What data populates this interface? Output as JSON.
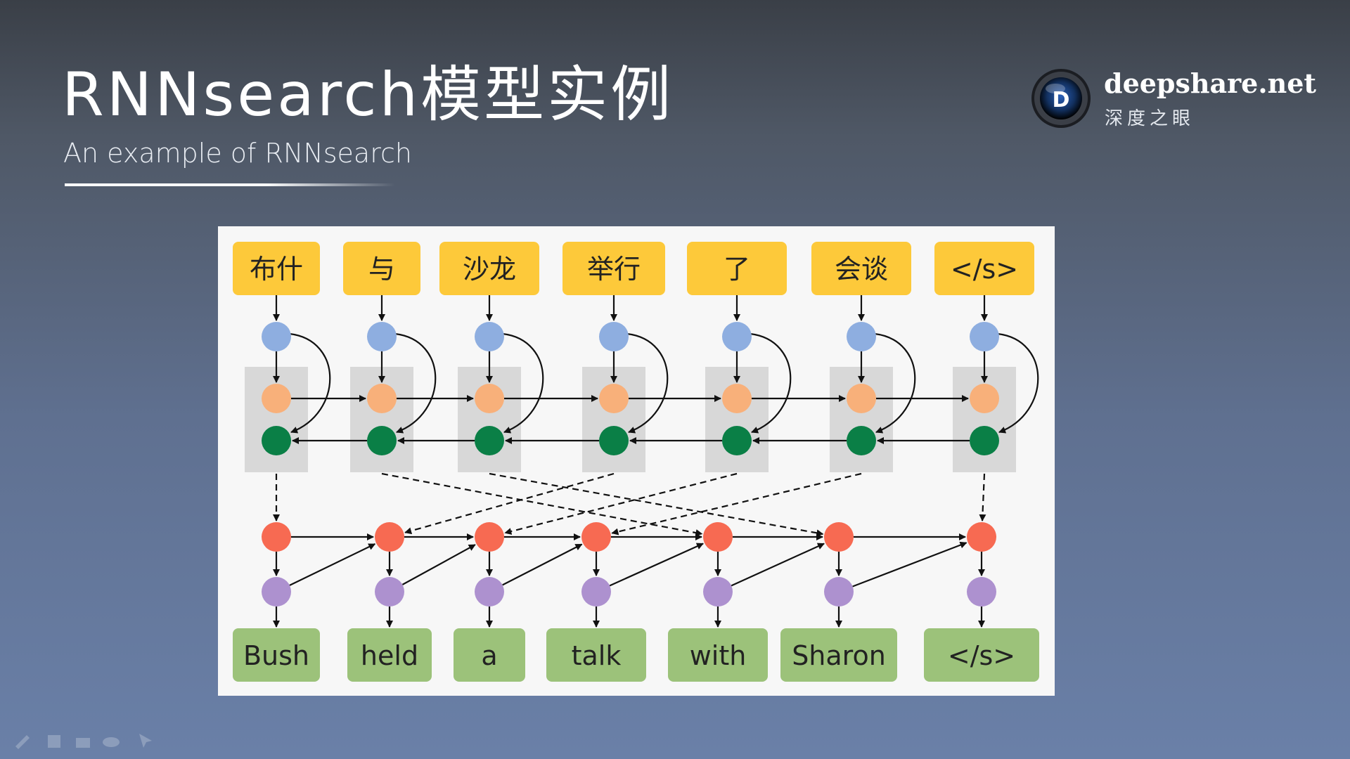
{
  "slide": {
    "title": "RNNsearch模型实例",
    "subtitle": "An example of RNNsearch"
  },
  "logo": {
    "name": "deepshare.net",
    "subtitle": "深度之眼",
    "icon_letter": "D"
  },
  "diagram": {
    "source_tokens": [
      "布什",
      "与",
      "沙龙",
      "举行",
      "了",
      "会谈",
      "</s>"
    ],
    "target_tokens": [
      "Bush",
      "held",
      "a",
      "talk",
      "with",
      "Sharon",
      "</s>"
    ],
    "alignment": [
      0,
      3,
      4,
      5,
      1,
      2,
      6
    ],
    "colors": {
      "token_box_source": "#fdc93a",
      "token_box_target": "#9cc27a",
      "embedding_node": "#8eaee0",
      "forward_node": "#f8b07a",
      "backward_node": "#0a7f46",
      "decoder_state_node": "#f76a52",
      "output_node": "#ad91cf",
      "encoder_block": "#d8d8d8"
    }
  },
  "toolbar": {
    "icons": [
      "pen-icon",
      "highlighter-icon",
      "eraser-icon",
      "view-icon",
      "pointer-icon"
    ]
  }
}
